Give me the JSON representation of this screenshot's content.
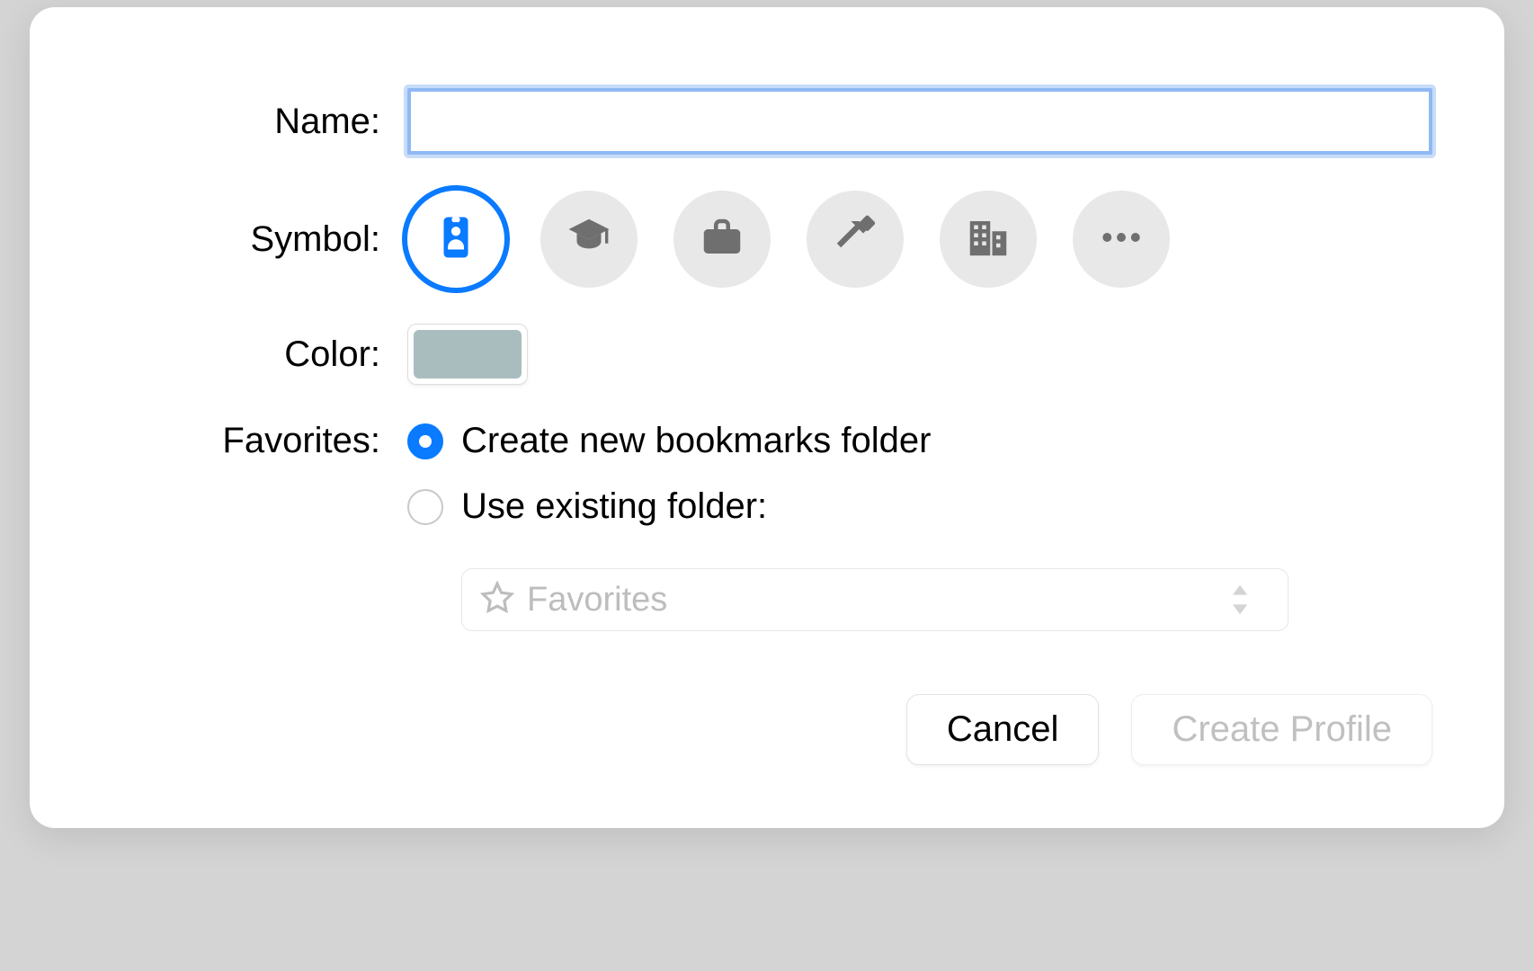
{
  "labels": {
    "name": "Name:",
    "symbol": "Symbol:",
    "color": "Color:",
    "favorites": "Favorites:"
  },
  "nameInput": {
    "value": ""
  },
  "symbols": {
    "selectedIndex": 0,
    "options": [
      {
        "id": "badge"
      },
      {
        "id": "graduation-cap"
      },
      {
        "id": "briefcase"
      },
      {
        "id": "hammer"
      },
      {
        "id": "buildings"
      },
      {
        "id": "more"
      }
    ]
  },
  "color": {
    "value": "#a9bdbf"
  },
  "favorites": {
    "selected": "create",
    "options": {
      "create": "Create new bookmarks folder",
      "existing": "Use existing folder:"
    },
    "existingSelect": {
      "value": "Favorites"
    }
  },
  "buttons": {
    "cancel": "Cancel",
    "create": "Create Profile"
  }
}
